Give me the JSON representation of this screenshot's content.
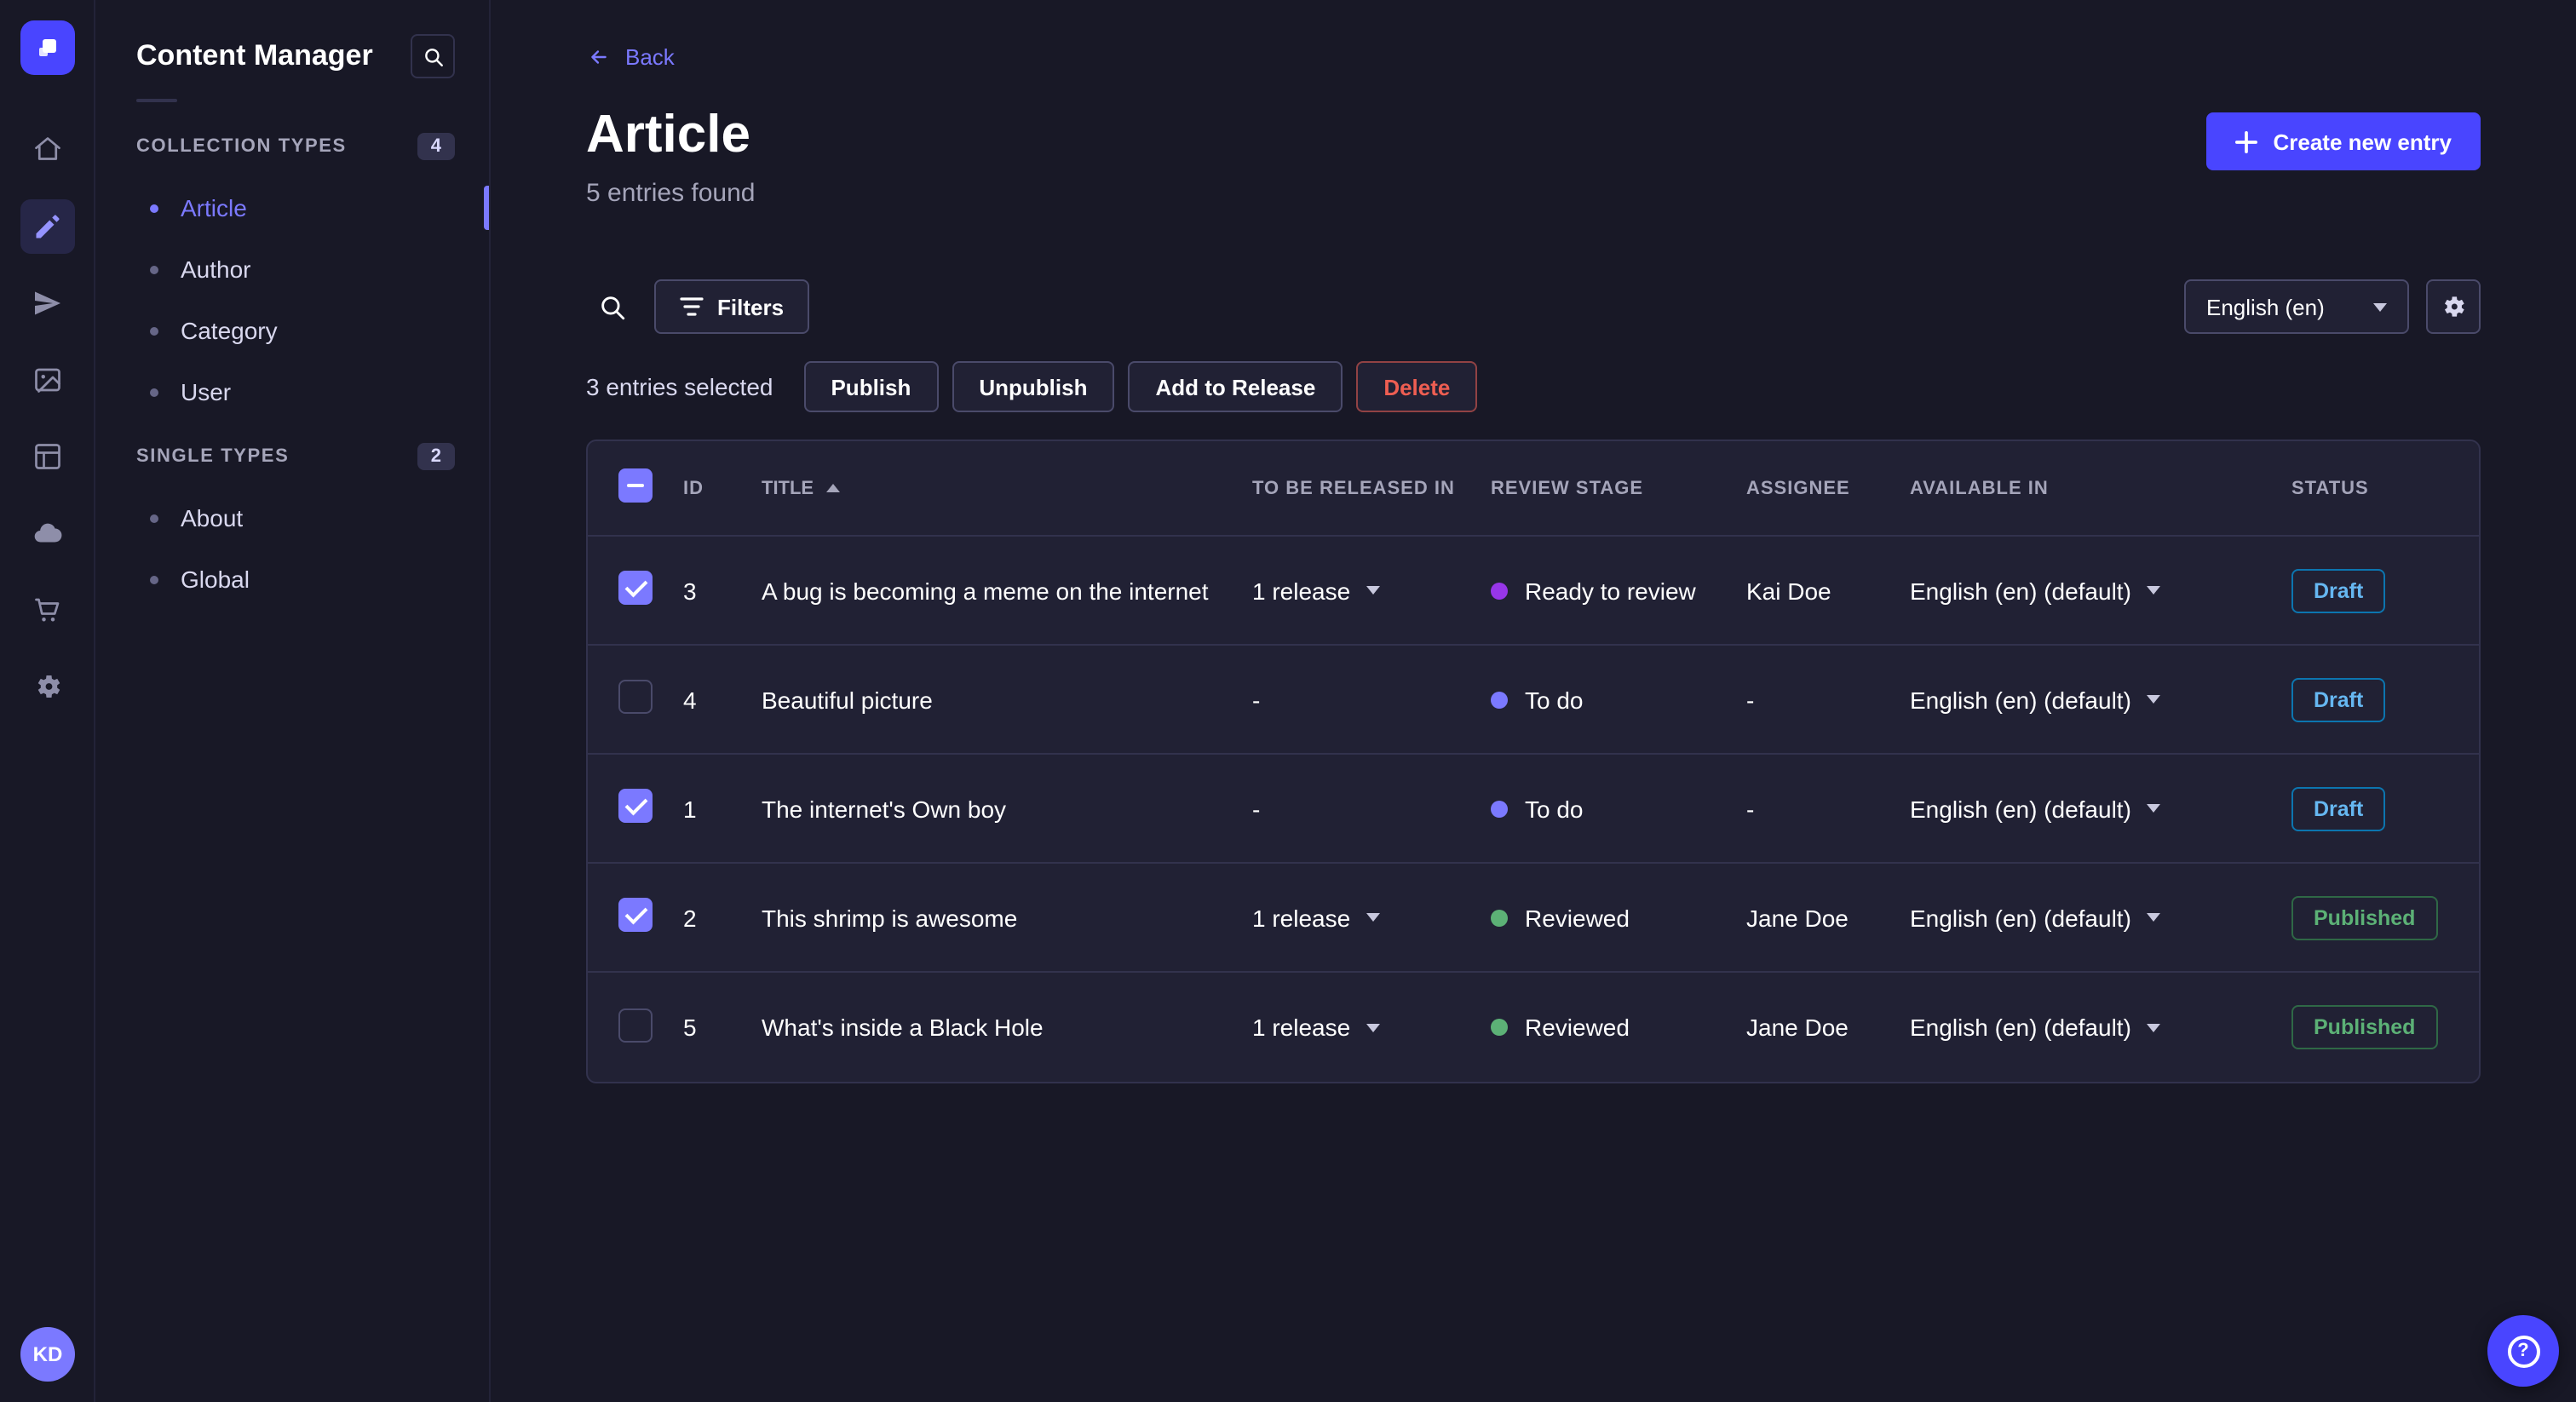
{
  "colors": {
    "accent": "#4945ff",
    "link": "#7b79ff",
    "draft": "#66b7f1",
    "published": "#5cb176",
    "danger": "#ee5e52",
    "stage_ready_to_review": "#9736e8",
    "stage_to_do": "#7b79ff",
    "stage_reviewed": "#5cb176"
  },
  "nav": {
    "icons": [
      "strapi-logo",
      "home-icon",
      "content-manager-icon",
      "releases-icon",
      "media-library-icon",
      "content-type-builder-icon",
      "cloud-icon",
      "marketplace-icon",
      "settings-icon"
    ],
    "active_icon": "content-manager-icon",
    "avatar_initials": "KD"
  },
  "sidebar": {
    "title": "Content Manager",
    "sections": [
      {
        "label": "COLLECTION TYPES",
        "badge": "4",
        "items": [
          {
            "label": "Article",
            "active": true
          },
          {
            "label": "Author",
            "active": false
          },
          {
            "label": "Category",
            "active": false
          },
          {
            "label": "User",
            "active": false
          }
        ]
      },
      {
        "label": "SINGLE TYPES",
        "badge": "2",
        "items": [
          {
            "label": "About",
            "active": false
          },
          {
            "label": "Global",
            "active": false
          }
        ]
      }
    ]
  },
  "header": {
    "back_label": "Back",
    "title": "Article",
    "subtitle": "5 entries found",
    "create_button_label": "Create new entry"
  },
  "toolbar": {
    "filters_label": "Filters",
    "locale_selected": "English (en)"
  },
  "selection": {
    "count_text": "3 entries selected",
    "publish_label": "Publish",
    "unpublish_label": "Unpublish",
    "add_to_release_label": "Add to Release",
    "delete_label": "Delete"
  },
  "table": {
    "headers": {
      "id": "ID",
      "title": "TITLE",
      "to_be_released_in": "TO BE RELEASED IN",
      "review_stage": "REVIEW STAGE",
      "assignee": "ASSIGNEE",
      "available_in": "AVAILABLE IN",
      "status": "STATUS"
    },
    "rows": [
      {
        "selected": true,
        "id": "3",
        "title": "A bug is becoming a meme on the internet",
        "release": "1 release",
        "stage": "Ready to review",
        "stage_color": "#9736e8",
        "assignee": "Kai Doe",
        "available_in": "English (en) (default)",
        "status": "Draft"
      },
      {
        "selected": false,
        "id": "4",
        "title": "Beautiful picture",
        "release": "-",
        "stage": "To do",
        "stage_color": "#7b79ff",
        "assignee": "-",
        "available_in": "English (en) (default)",
        "status": "Draft"
      },
      {
        "selected": true,
        "id": "1",
        "title": "The internet's Own boy",
        "release": "-",
        "stage": "To do",
        "stage_color": "#7b79ff",
        "assignee": "-",
        "available_in": "English (en) (default)",
        "status": "Draft"
      },
      {
        "selected": true,
        "id": "2",
        "title": "This shrimp is awesome",
        "release": "1 release",
        "stage": "Reviewed",
        "stage_color": "#5cb176",
        "assignee": "Jane Doe",
        "available_in": "English (en) (default)",
        "status": "Published"
      },
      {
        "selected": false,
        "id": "5",
        "title": "What's inside a Black Hole",
        "release": "1 release",
        "stage": "Reviewed",
        "stage_color": "#5cb176",
        "assignee": "Jane Doe",
        "available_in": "English (en) (default)",
        "status": "Published"
      }
    ]
  }
}
